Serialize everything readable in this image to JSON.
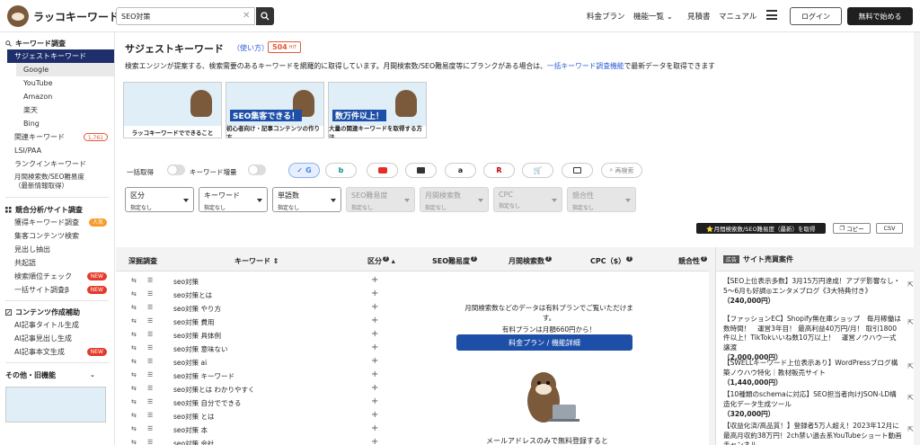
{
  "header": {
    "logo": "ラッコキーワード",
    "search_value": "SEO対策",
    "nav": [
      "料金プラン",
      "機能一覧 ⌄",
      "見積書",
      "マニュアル"
    ],
    "login": "ログイン",
    "free": "無料で始める"
  },
  "sidebar": {
    "s1": "キーワード調査",
    "s1_items": {
      "suggest": "サジェストキーワード",
      "google": "Google",
      "youtube": "YouTube",
      "amazon": "Amazon",
      "rakuten": "楽天",
      "bing": "Bing",
      "related": "関連キーワード",
      "related_badge": "1,761",
      "lsi": "LSI/PAA",
      "rankin": "ランクインキーワード",
      "vol1": "月間検索数/SEO難易度",
      "vol2": "（最新情報取得）"
    },
    "s2": "競合分析/サイト調査",
    "s2_items": {
      "acquired": "獲得キーワード調査",
      "acquired_badge": "人気",
      "content": "集客コンテンツ検索",
      "heading": "見出し抽出",
      "cooccur": "共起語",
      "rank": "検索順位チェック",
      "rank_badge": "NEW",
      "bulk": "一括サイト調査β",
      "bulk_badge": "NEW"
    },
    "s3": "コンテンツ作成補助",
    "s3_items": {
      "title": "AI記事タイトル生成",
      "head": "AI記事見出し生成",
      "body": "AI記事本文生成",
      "body_badge": "NEW"
    },
    "s4": "その他・旧機能"
  },
  "main": {
    "title": "サジェストキーワード",
    "usage": "（使い方）",
    "hits": "504",
    "hits_unit": "HIT",
    "desc1": "検索エンジンが提案する、検索需要のあるキーワードを網羅的に取得しています。月間検索数/SEO難易度等にブランクがある場合は、",
    "desc_link": "一括キーワード調査機能",
    "desc2": "で最新データを取得できます",
    "banners": [
      {
        "title": "ラッコキーワードでできること",
        "headline": ""
      },
      {
        "title": "初心者向け・記事コンテンツの作り方",
        "headline": "SEO集客できる！"
      },
      {
        "title": "大量の関連キーワードを取得する方法",
        "headline": "数万件以上！"
      }
    ],
    "toggle1": "一括取得",
    "toggle2": "キーワード増量",
    "reserch": "再検索",
    "filters": [
      {
        "label": "区分",
        "value": "指定なし"
      },
      {
        "label": "キーワード",
        "value": "指定なし"
      },
      {
        "label": "単語数",
        "value": "指定なし"
      },
      {
        "label": "SEO難易度",
        "value": "指定なし"
      },
      {
        "label": "月間検索数",
        "value": "指定なし"
      },
      {
        "label": "CPC",
        "value": "指定なし"
      },
      {
        "label": "競合性",
        "value": "指定なし"
      }
    ],
    "btn_latest": "⭐月間検索数/SEO難易度（最新）を取得",
    "btn_copy": "コピー",
    "btn_csv": "CSV",
    "table_headers": {
      "deep": "深掘調査",
      "kw": "キーワード ⇕",
      "kubun": "区分",
      "seo": "SEO難易度",
      "vol": "月間検索数",
      "cpc": "CPC（$）",
      "comp": "競合性"
    },
    "rows": [
      "seo対策",
      "seo対策とは",
      "seo対策 やり方",
      "seo対策 費用",
      "seo対策 具体例",
      "seo対策 意味ない",
      "seo対策 ai",
      "seo対策 キーワード",
      "seo対策とは わかりやすく",
      "seo対策 自分でできる",
      "seo対策 とは",
      "seo対策 本",
      "seo対策 会社"
    ],
    "paid1": "月間検索数などのデータは有料プランでご覧いただけます。",
    "paid2": "有料プランは月額660円から！",
    "paid_btn": "料金プラン / 機能詳細",
    "mail": "メールアドレスのみで無料登録すると"
  },
  "ads": {
    "tag": "広告",
    "header": "サイト売買案件",
    "items": [
      {
        "text": "【SEO上位表示多数】3月15万円達成！アプデ影響なし・5〜6月も好調◎エンタメブログ《3大特典付き》",
        "price": "（240,000円）"
      },
      {
        "text": "【ファッションEC】Shopify無在庫ショップ　毎月稼働は数時間！　運営3年目！ 最高利益40万円/月！ 取引1800件以上！TikTokいいね数10万以上！　運営ノウハウ一式譲渡",
        "price": "（2,000,000円）"
      },
      {
        "text": "【SWELLキーワード上位表示あり】WordPressブログ構築ノウハウ特化｜教材販売サイト",
        "price": "（1,440,000円）"
      },
      {
        "text": "【10種類のschemaに対応】SEO担当者向けJSON-LD構造化データ生成ツール",
        "price": "（320,000円）"
      },
      {
        "text": "【収益化済/高品質！】登録者5万人超え！2023年12月に最高月収約38万円！2ch禁い過去系YouTubeショート動画チャンネル",
        "price": ""
      }
    ]
  }
}
